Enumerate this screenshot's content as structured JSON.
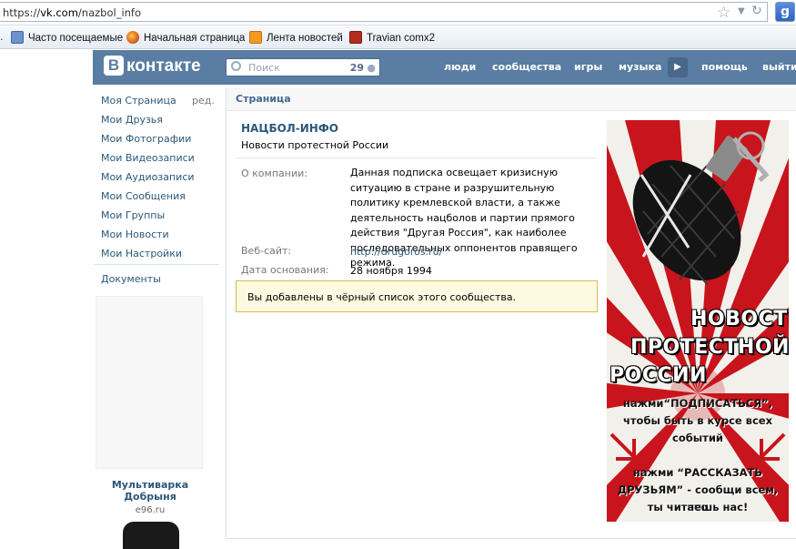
{
  "browser": {
    "url_scheme": "https://",
    "url_domain": "vk.com",
    "url_path": "/nazbol_info",
    "search_engine_button": "g",
    "bookmarks": [
      {
        "label": "Часто посещаемые",
        "icon": "frequently-visited-icon"
      },
      {
        "label": "Начальная страница",
        "icon": "firefox-icon"
      },
      {
        "label": "Лента новостей",
        "icon": "rss-feed-icon"
      },
      {
        "label": "Travian comx2",
        "icon": "travian-icon"
      }
    ]
  },
  "header": {
    "logo_letter": "В",
    "logo_text": "контакте",
    "search_placeholder": "Поиск",
    "search_count": "29",
    "nav": [
      "люди",
      "сообщества",
      "игры",
      "музыка",
      "помощь",
      "выйти"
    ],
    "accent_color": "#597da3"
  },
  "left_menu": {
    "items": [
      "Моя Страница",
      "Мои Друзья",
      "Мои Фотографии",
      "Мои Видеозаписи",
      "Мои Аудиозаписи",
      "Мои Сообщения",
      "Мои Группы",
      "Мои Новости",
      "Мои Настройки"
    ],
    "edit_label": "ред.",
    "documents": "Документы",
    "ad": {
      "title": "Мультиварка Добрыня",
      "domain": "e96.ru"
    }
  },
  "main": {
    "breadcrumb": "Страница",
    "group_name": "НАЦБОЛ-ИНФО",
    "status": "Новости протестной России",
    "info": {
      "about_label": "О компании:",
      "about_value": "Данная подписка освещает кризисную ситуацию в стране и разрушительную политику кремлевской власти, а также деятельность нацболов и партии прямого действия \"Другая Россия\", как наиболее последовательных оппонентов правящего режима.",
      "site_label": "Веб-сайт:",
      "site_value": "http://drugoros.ru/",
      "founded_label": "Дата основания:",
      "founded_value": "28 ноября 1994"
    },
    "notice": "Вы добавлены в чёрный список этого сообщества.",
    "poster": {
      "title_lines": [
        "НОВОСТИ",
        "ПРОТЕСТНОЙ",
        "РОССИИ"
      ],
      "line1": "нажми“ПОДПИСАТЬСЯ”,",
      "line2": "чтобы быть в курсе всех",
      "line3": "событий",
      "line4": "нажми “РАССКАЗАТЬ",
      "line5": "ДРУЗЬЯМ” - сообщи всем, что",
      "line6": "ты читаешь нас!",
      "colors": {
        "ray": "#c8141c",
        "background": "#f2f0ea"
      }
    }
  }
}
